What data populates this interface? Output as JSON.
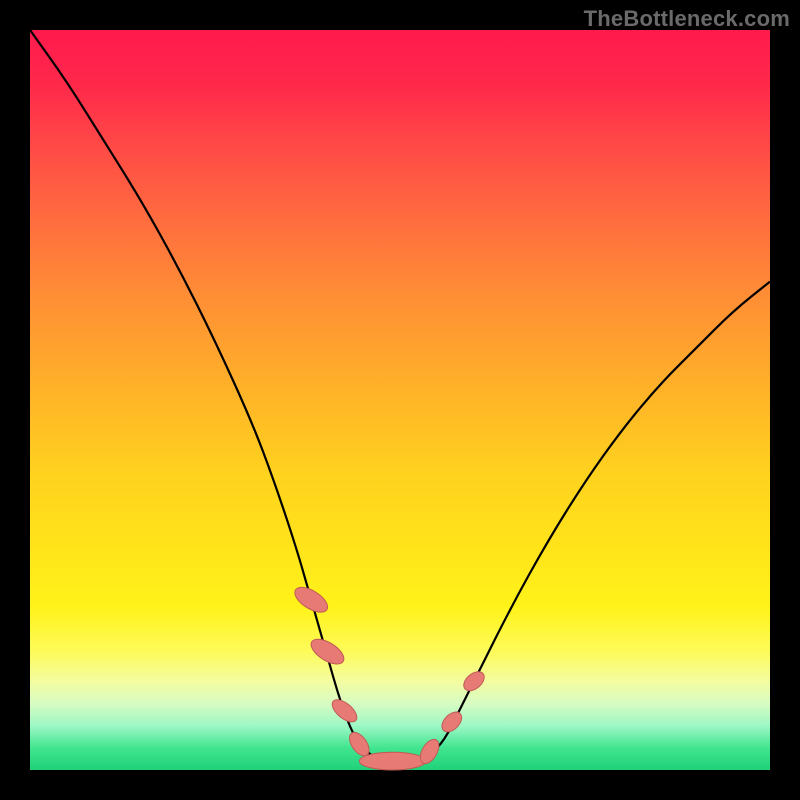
{
  "watermark": "TheBottleneck.com",
  "colors": {
    "frame": "#000000",
    "curve_stroke": "#000000",
    "marker_fill": "#e77a74",
    "marker_stroke": "#c05a55"
  },
  "chart_data": {
    "type": "line",
    "title": "",
    "xlabel": "",
    "ylabel": "",
    "xlim": [
      0,
      100
    ],
    "ylim": [
      0,
      100
    ],
    "grid": false,
    "legend": false,
    "series": [
      {
        "name": "bottleneck-curve",
        "x": [
          0,
          5,
          10,
          15,
          20,
          25,
          30,
          33,
          36,
          38,
          40,
          42,
          44,
          46,
          48,
          50,
          52,
          54,
          56,
          58,
          60,
          65,
          70,
          75,
          80,
          85,
          90,
          95,
          100
        ],
        "y": [
          100,
          93,
          85,
          77,
          68,
          58,
          47,
          39,
          30,
          23,
          16,
          9,
          4,
          2,
          1,
          1,
          1,
          2,
          4,
          8,
          12,
          22,
          31,
          39,
          46,
          52,
          57,
          62,
          66
        ]
      }
    ],
    "markers": [
      {
        "name": "bead-1",
        "x": 38.0,
        "y": 23,
        "rx": 1.2,
        "ry": 2.5,
        "rot": -58
      },
      {
        "name": "bead-2",
        "x": 40.2,
        "y": 16,
        "rx": 1.2,
        "ry": 2.5,
        "rot": -58
      },
      {
        "name": "bead-3",
        "x": 42.5,
        "y": 8,
        "rx": 1.0,
        "ry": 2.0,
        "rot": -50
      },
      {
        "name": "bead-4",
        "x": 44.5,
        "y": 3.5,
        "rx": 1.0,
        "ry": 1.8,
        "rot": -35
      },
      {
        "name": "bead-5",
        "x": 49.0,
        "y": 1.2,
        "rx": 4.5,
        "ry": 1.2,
        "rot": 0
      },
      {
        "name": "bead-6",
        "x": 54.0,
        "y": 2.5,
        "rx": 1.0,
        "ry": 1.8,
        "rot": 30
      },
      {
        "name": "bead-7",
        "x": 57.0,
        "y": 6.5,
        "rx": 1.0,
        "ry": 1.6,
        "rot": 45
      },
      {
        "name": "bead-8",
        "x": 60.0,
        "y": 12,
        "rx": 1.0,
        "ry": 1.6,
        "rot": 50
      }
    ]
  }
}
